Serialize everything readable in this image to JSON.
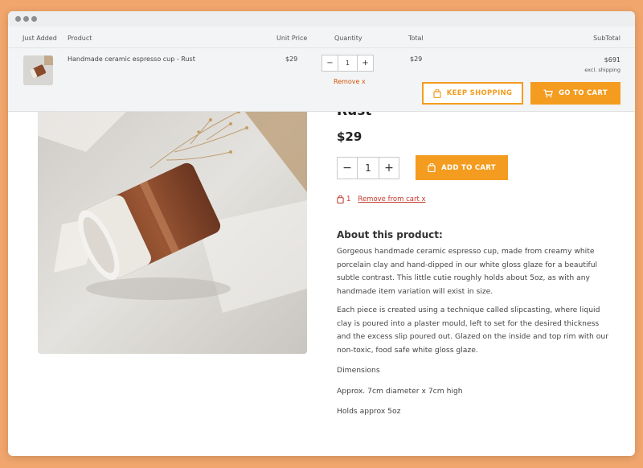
{
  "product": {
    "title_fragment": "Rust",
    "price": "$29",
    "quantity": "1",
    "add_to_cart_label": "ADD TO CART",
    "cart_count": "1",
    "remove_label": "Remove from cart x",
    "about_heading": "About this product:",
    "description_1": "Gorgeous handmade ceramic espresso cup, made from creamy white porcelain clay and hand-dipped in our white gloss glaze for a beautiful subtle contrast. This little cutie roughly holds about 5oz, as with any handmade item variation will exist in size.",
    "description_2": "Each piece is created using a technique called slipcasting, where liquid clay is poured into a plaster mould, left to set for the desired thickness and the excess slip poured out. Glazed on the inside and top rim with our non-toxic, food safe white gloss glaze.",
    "dimensions_label": "Dimensions",
    "dimensions_value": "Approx. 7cm diameter x 7cm high",
    "capacity": "Holds approx 5oz"
  },
  "cart": {
    "headers": {
      "just_added": "Just Added",
      "product": "Product",
      "unit_price": "Unit Price",
      "quantity": "Quantity",
      "total": "Total",
      "subtotal": "SubTotal"
    },
    "item": {
      "name": "Handmade ceramic espresso cup - Rust",
      "unit_price": "$29",
      "quantity": "1",
      "total": "$29",
      "remove_label": "Remove x"
    },
    "subtotal": "$691",
    "subtotal_note": "excl. shipping",
    "keep_shopping_label": "KEEP SHOPPING",
    "go_to_cart_label": "GO TO CART"
  },
  "colors": {
    "accent": "#f39c1f",
    "remove": "#c0392b",
    "background": "#f0a66c"
  },
  "icons": [
    "bag-icon",
    "cart-icon",
    "minus-icon",
    "plus-icon"
  ]
}
